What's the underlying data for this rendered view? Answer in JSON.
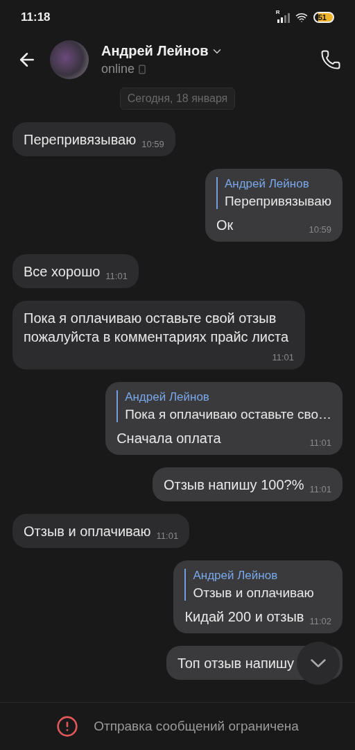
{
  "status_bar": {
    "time": "11:18",
    "roaming": "R",
    "battery": "51"
  },
  "header": {
    "name": "Андрей Лейнов",
    "status": "online"
  },
  "date_chip": "Сегодня, 18 января",
  "messages": [
    {
      "kind": "incoming",
      "text": "Перепривязываю",
      "time": "10:59"
    },
    {
      "kind": "outgoing",
      "reply": {
        "author": "Андрей Лейнов",
        "text": "Перепривязываю"
      },
      "text": "Ок",
      "time": "10:59"
    },
    {
      "kind": "incoming",
      "text": "Все хорошо",
      "time": "11:01"
    },
    {
      "kind": "incoming",
      "text": "Пока я оплачиваю оставьте свой отзыв пожалуйста в комментариях прайс листа",
      "time": "11:01"
    },
    {
      "kind": "outgoing",
      "reply": {
        "author": "Андрей Лейнов",
        "text": "Пока я оплачиваю оставьте сво…"
      },
      "text": "Сначала оплата",
      "time": "11:01"
    },
    {
      "kind": "outgoing",
      "text": "Отзыв напишу 100?%",
      "time": "11:01"
    },
    {
      "kind": "incoming",
      "text": "Отзыв и оплачиваю",
      "time": "11:01"
    },
    {
      "kind": "outgoing",
      "reply": {
        "author": "Андрей Лейнов",
        "text": "Отзыв и оплачиваю"
      },
      "text": "Кидай 200 и отзыв",
      "time": "11:02"
    },
    {
      "kind": "outgoing",
      "text": "Топ отзыв напишу"
    }
  ],
  "notice": "Отправка сообщений ограничена"
}
